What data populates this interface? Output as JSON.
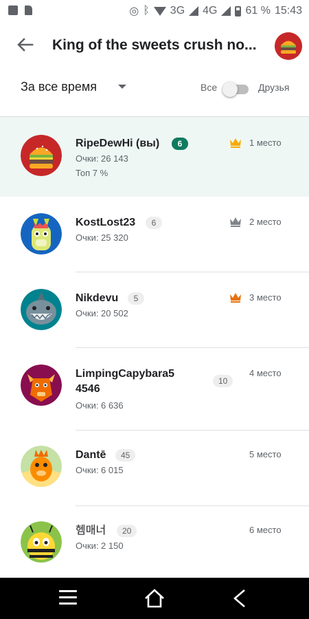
{
  "status_bar": {
    "icons": [
      "image-icon",
      "file-icon",
      "data-saver-icon",
      "bluetooth-icon",
      "wifi-icon",
      "signal-icon",
      "battery-icon"
    ],
    "network_3g": "3G",
    "network_4g": "4G",
    "battery": "61 %",
    "time": "15:43"
  },
  "header": {
    "title": "King of the sweets crush no..."
  },
  "filter": {
    "period": "За все время",
    "all_label": "Все",
    "friends_label": "Друзья",
    "friends_toggle_on": false
  },
  "leaderboard": {
    "score_prefix": "Очки:",
    "players": [
      {
        "name": "RipeDewHi (вы)",
        "level": "6",
        "score": "Очки: 26 143",
        "extra": "Топ 7 %",
        "place": "1 место",
        "crown": "gold",
        "crown_color": "#f9ab00"
      },
      {
        "name": "KostLost23",
        "level": "6",
        "score": "Очки: 25 320",
        "place": "2 место",
        "crown": "silver",
        "crown_color": "#80868b"
      },
      {
        "name": "Nikdevu",
        "level": "5",
        "score": "Очки: 20 502",
        "place": "3 место",
        "crown": "bronze",
        "crown_color": "#e8710a"
      },
      {
        "name_line1": "LimpingCapybara5",
        "name_line2": "4546",
        "level": "10",
        "score": "Очки: 6 636",
        "place": "4 место"
      },
      {
        "name": "Dantē",
        "level": "45",
        "score": "Очки: 6 015",
        "place": "5 место"
      },
      {
        "name": "헴매너",
        "level": "20",
        "score": "Очки: 2 150",
        "place": "6 место"
      }
    ]
  },
  "colors": {
    "highlight_row": "#eef7f4",
    "level_badge_self": "#0f7b5f",
    "navbar": "#000000"
  },
  "navbar": {
    "icons": [
      "menu-icon",
      "home-icon",
      "back-icon"
    ]
  }
}
